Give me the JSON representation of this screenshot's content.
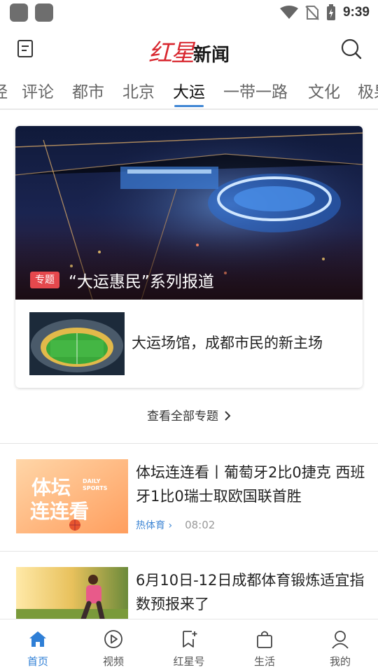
{
  "status_bar": {
    "time": "9:39"
  },
  "header": {
    "logo_red": "红星",
    "logo_black": "新闻"
  },
  "tabs": [
    {
      "label": "经"
    },
    {
      "label": "评论"
    },
    {
      "label": "都市"
    },
    {
      "label": "北京"
    },
    {
      "label": "大运",
      "active": true
    },
    {
      "label": "一带一路"
    },
    {
      "label": "文化"
    },
    {
      "label": "极果"
    }
  ],
  "special": {
    "badge": "专题",
    "title": "“大运惠民”系列报道",
    "sub_item_title": "大运场馆，成都市民的新主场",
    "view_all": "查看全部专题"
  },
  "articles": [
    {
      "title": "体坛连连看丨葡萄牙2比0捷克 西班牙1比0瑞士取欧国联首胜",
      "source": "热体育 ›",
      "time": "08:02",
      "thumb_text_1": "体坛",
      "thumb_text_2": "连连看",
      "thumb_tag_1": "DAILY",
      "thumb_tag_2": "SPORTS"
    },
    {
      "title": "6月10日-12日成都体育锻炼适宜指数预报来了",
      "source": "",
      "time": ""
    }
  ],
  "bottom_nav": [
    {
      "label": "首页",
      "icon": "home-icon",
      "active": true
    },
    {
      "label": "视频",
      "icon": "play-icon"
    },
    {
      "label": "红星号",
      "icon": "bookmark-star-icon"
    },
    {
      "label": "生活",
      "icon": "shopping-bag-icon"
    },
    {
      "label": "我的",
      "icon": "person-icon"
    }
  ],
  "colors": {
    "accent": "#3f86d4",
    "brand_red": "#d8262e",
    "badge_red": "#e5484d",
    "nav_active": "#2f7fd6"
  }
}
